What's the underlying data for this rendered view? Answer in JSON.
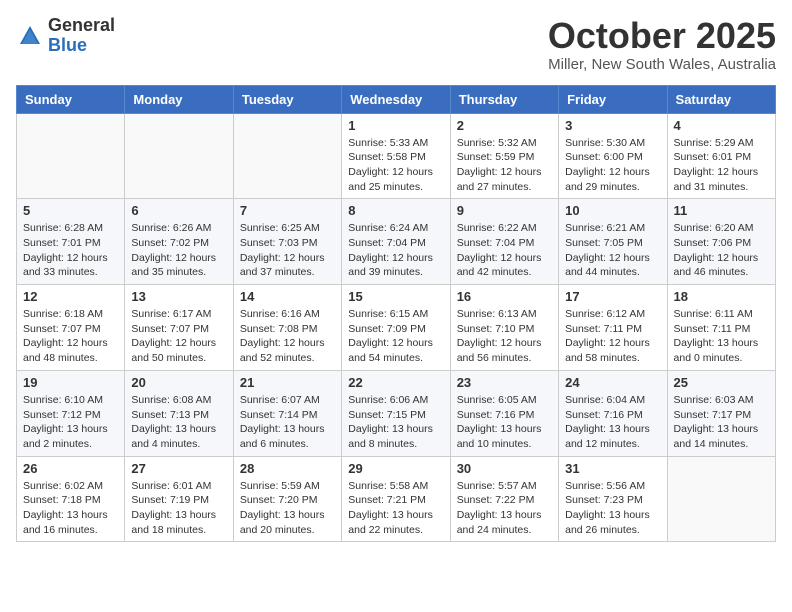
{
  "header": {
    "logo_general": "General",
    "logo_blue": "Blue",
    "month_title": "October 2025",
    "location": "Miller, New South Wales, Australia"
  },
  "weekdays": [
    "Sunday",
    "Monday",
    "Tuesday",
    "Wednesday",
    "Thursday",
    "Friday",
    "Saturday"
  ],
  "weeks": [
    [
      {
        "day": "",
        "info": ""
      },
      {
        "day": "",
        "info": ""
      },
      {
        "day": "",
        "info": ""
      },
      {
        "day": "1",
        "info": "Sunrise: 5:33 AM\nSunset: 5:58 PM\nDaylight: 12 hours\nand 25 minutes."
      },
      {
        "day": "2",
        "info": "Sunrise: 5:32 AM\nSunset: 5:59 PM\nDaylight: 12 hours\nand 27 minutes."
      },
      {
        "day": "3",
        "info": "Sunrise: 5:30 AM\nSunset: 6:00 PM\nDaylight: 12 hours\nand 29 minutes."
      },
      {
        "day": "4",
        "info": "Sunrise: 5:29 AM\nSunset: 6:01 PM\nDaylight: 12 hours\nand 31 minutes."
      }
    ],
    [
      {
        "day": "5",
        "info": "Sunrise: 6:28 AM\nSunset: 7:01 PM\nDaylight: 12 hours\nand 33 minutes."
      },
      {
        "day": "6",
        "info": "Sunrise: 6:26 AM\nSunset: 7:02 PM\nDaylight: 12 hours\nand 35 minutes."
      },
      {
        "day": "7",
        "info": "Sunrise: 6:25 AM\nSunset: 7:03 PM\nDaylight: 12 hours\nand 37 minutes."
      },
      {
        "day": "8",
        "info": "Sunrise: 6:24 AM\nSunset: 7:04 PM\nDaylight: 12 hours\nand 39 minutes."
      },
      {
        "day": "9",
        "info": "Sunrise: 6:22 AM\nSunset: 7:04 PM\nDaylight: 12 hours\nand 42 minutes."
      },
      {
        "day": "10",
        "info": "Sunrise: 6:21 AM\nSunset: 7:05 PM\nDaylight: 12 hours\nand 44 minutes."
      },
      {
        "day": "11",
        "info": "Sunrise: 6:20 AM\nSunset: 7:06 PM\nDaylight: 12 hours\nand 46 minutes."
      }
    ],
    [
      {
        "day": "12",
        "info": "Sunrise: 6:18 AM\nSunset: 7:07 PM\nDaylight: 12 hours\nand 48 minutes."
      },
      {
        "day": "13",
        "info": "Sunrise: 6:17 AM\nSunset: 7:07 PM\nDaylight: 12 hours\nand 50 minutes."
      },
      {
        "day": "14",
        "info": "Sunrise: 6:16 AM\nSunset: 7:08 PM\nDaylight: 12 hours\nand 52 minutes."
      },
      {
        "day": "15",
        "info": "Sunrise: 6:15 AM\nSunset: 7:09 PM\nDaylight: 12 hours\nand 54 minutes."
      },
      {
        "day": "16",
        "info": "Sunrise: 6:13 AM\nSunset: 7:10 PM\nDaylight: 12 hours\nand 56 minutes."
      },
      {
        "day": "17",
        "info": "Sunrise: 6:12 AM\nSunset: 7:11 PM\nDaylight: 12 hours\nand 58 minutes."
      },
      {
        "day": "18",
        "info": "Sunrise: 6:11 AM\nSunset: 7:11 PM\nDaylight: 13 hours\nand 0 minutes."
      }
    ],
    [
      {
        "day": "19",
        "info": "Sunrise: 6:10 AM\nSunset: 7:12 PM\nDaylight: 13 hours\nand 2 minutes."
      },
      {
        "day": "20",
        "info": "Sunrise: 6:08 AM\nSunset: 7:13 PM\nDaylight: 13 hours\nand 4 minutes."
      },
      {
        "day": "21",
        "info": "Sunrise: 6:07 AM\nSunset: 7:14 PM\nDaylight: 13 hours\nand 6 minutes."
      },
      {
        "day": "22",
        "info": "Sunrise: 6:06 AM\nSunset: 7:15 PM\nDaylight: 13 hours\nand 8 minutes."
      },
      {
        "day": "23",
        "info": "Sunrise: 6:05 AM\nSunset: 7:16 PM\nDaylight: 13 hours\nand 10 minutes."
      },
      {
        "day": "24",
        "info": "Sunrise: 6:04 AM\nSunset: 7:16 PM\nDaylight: 13 hours\nand 12 minutes."
      },
      {
        "day": "25",
        "info": "Sunrise: 6:03 AM\nSunset: 7:17 PM\nDaylight: 13 hours\nand 14 minutes."
      }
    ],
    [
      {
        "day": "26",
        "info": "Sunrise: 6:02 AM\nSunset: 7:18 PM\nDaylight: 13 hours\nand 16 minutes."
      },
      {
        "day": "27",
        "info": "Sunrise: 6:01 AM\nSunset: 7:19 PM\nDaylight: 13 hours\nand 18 minutes."
      },
      {
        "day": "28",
        "info": "Sunrise: 5:59 AM\nSunset: 7:20 PM\nDaylight: 13 hours\nand 20 minutes."
      },
      {
        "day": "29",
        "info": "Sunrise: 5:58 AM\nSunset: 7:21 PM\nDaylight: 13 hours\nand 22 minutes."
      },
      {
        "day": "30",
        "info": "Sunrise: 5:57 AM\nSunset: 7:22 PM\nDaylight: 13 hours\nand 24 minutes."
      },
      {
        "day": "31",
        "info": "Sunrise: 5:56 AM\nSunset: 7:23 PM\nDaylight: 13 hours\nand 26 minutes."
      },
      {
        "day": "",
        "info": ""
      }
    ]
  ]
}
